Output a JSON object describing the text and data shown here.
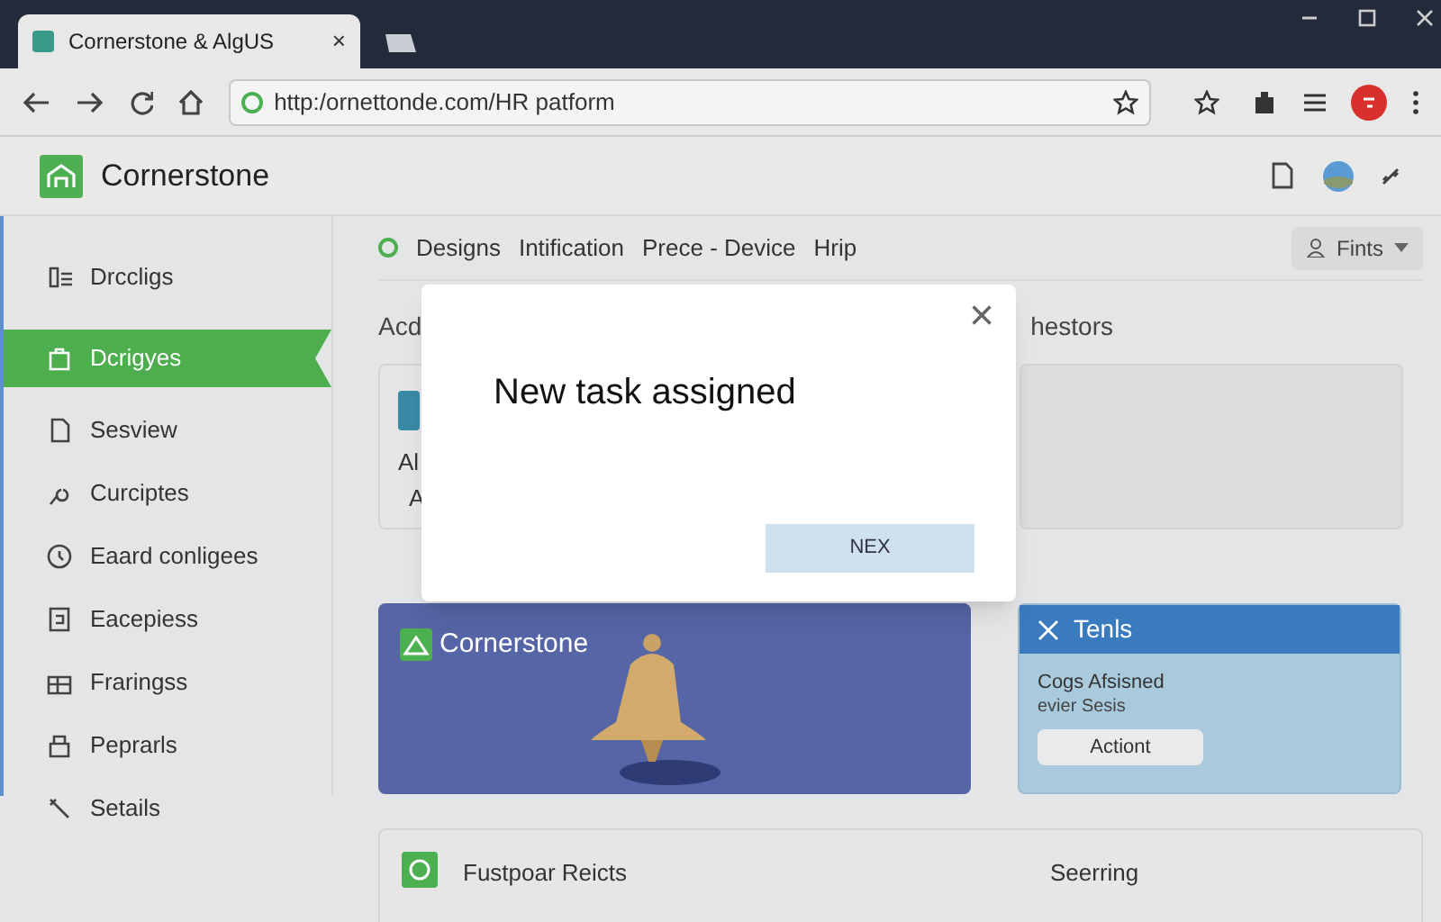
{
  "browser": {
    "tab_title": "Cornerstone & AlgUS",
    "tab_close": "×",
    "url": "http:/ornettondе.com/HR patform"
  },
  "app": {
    "title": "Cornerstone"
  },
  "sidebar": {
    "items": [
      {
        "label": "Drccligs",
        "selected": false
      },
      {
        "label": "Dcrigyes",
        "selected": true
      },
      {
        "label": "Sesview",
        "selected": false
      },
      {
        "label": "Curciptes",
        "selected": false
      },
      {
        "label": "Eaard conligees",
        "selected": false
      },
      {
        "label": "Eacepiess",
        "selected": false
      },
      {
        "label": "Fraringss",
        "selected": false
      },
      {
        "label": "Peprarls",
        "selected": false
      },
      {
        "label": "Setails",
        "selected": false
      }
    ]
  },
  "nav": {
    "items": [
      "Designs",
      "Intification",
      "Prece - Device",
      "Hrip"
    ],
    "filter_button": "Fints"
  },
  "section": {
    "left_heading": "Acd",
    "right_heading": "hestors",
    "card_lines": [
      "Al",
      "A"
    ]
  },
  "modal": {
    "title": "New task assigned",
    "close": "×",
    "button": "NEX"
  },
  "banner": {
    "title": "Cornerstone"
  },
  "tasks_card": {
    "title": "Tenls",
    "lines": [
      "Cogs Afsisned",
      "evier Sesis"
    ],
    "button": "Actiont"
  },
  "list_card": {
    "left": "Fustpoar Reicts",
    "right": "Seerring"
  }
}
